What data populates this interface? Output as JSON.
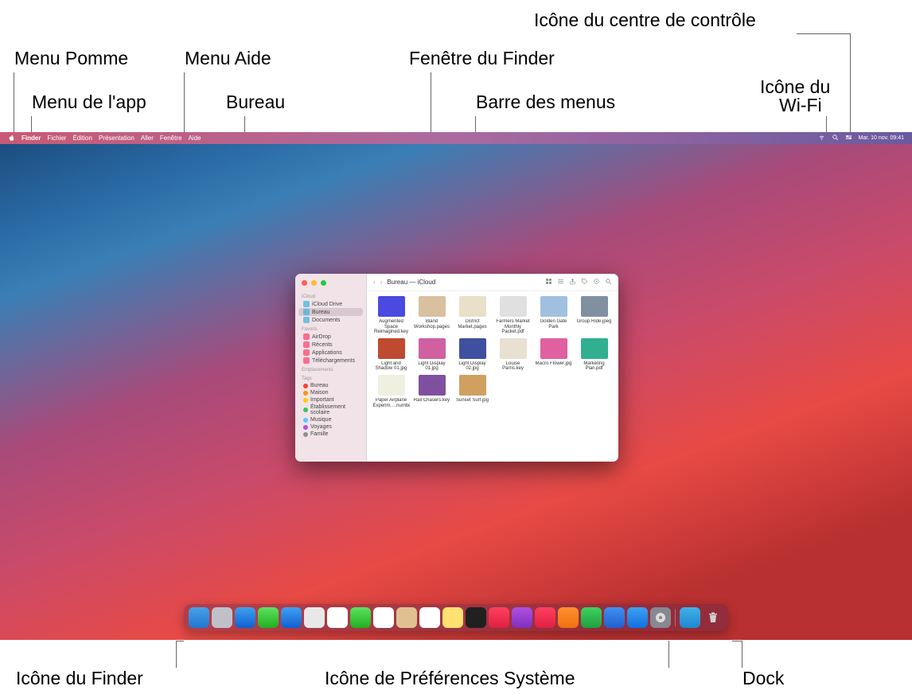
{
  "annotations": {
    "menuPomme": "Menu Pomme",
    "menuApp": "Menu de l'app",
    "menuAide": "Menu Aide",
    "bureau": "Bureau",
    "fenetreFinder": "Fenêtre du Finder",
    "barreMenus": "Barre des menus",
    "wifi1": "Icône du",
    "wifi2": "Wi-Fi",
    "controlCenter": "Icône du centre de contrôle",
    "finderIcon": "Icône du Finder",
    "sysPrefIcon": "Icône de Préférences Système",
    "dock": "Dock"
  },
  "menubar": {
    "items": [
      "Finder",
      "Fichier",
      "Édition",
      "Présentation",
      "Aller",
      "Fenêtre",
      "Aide"
    ],
    "datetime": "Mar. 10 nov.  09:41"
  },
  "finder": {
    "title": "Bureau — iCloud",
    "sidebar": {
      "sections": [
        {
          "header": "iCloud",
          "items": [
            {
              "label": "iCloud Drive",
              "icon": "cloud",
              "color": "#38b0de"
            },
            {
              "label": "Bureau",
              "icon": "folder",
              "color": "#38b0de",
              "selected": true
            },
            {
              "label": "Documents",
              "icon": "folder",
              "color": "#38b0de"
            }
          ]
        },
        {
          "header": "Favoris",
          "items": [
            {
              "label": "AirDrop",
              "icon": "airdrop",
              "color": "#ff3b6b"
            },
            {
              "label": "Récents",
              "icon": "clock",
              "color": "#ff3b6b"
            },
            {
              "label": "Applications",
              "icon": "app",
              "color": "#ff3b6b"
            },
            {
              "label": "Téléchargements",
              "icon": "download",
              "color": "#ff3b6b"
            }
          ]
        },
        {
          "header": "Emplacements",
          "items": []
        },
        {
          "header": "Tags",
          "items": [
            {
              "label": "Bureau",
              "dot": "#ff3b30"
            },
            {
              "label": "Maison",
              "dot": "#ff9500"
            },
            {
              "label": "Important",
              "dot": "#ffcc00"
            },
            {
              "label": "Établissement scolaire",
              "dot": "#34c759"
            },
            {
              "label": "Musique",
              "dot": "#5ac8fa"
            },
            {
              "label": "Voyages",
              "dot": "#af52de"
            },
            {
              "label": "Famille",
              "dot": "#8e8e93"
            }
          ]
        }
      ]
    },
    "files": [
      {
        "name": "Augmented Space Reimagined.key",
        "c": "#4a4ae0"
      },
      {
        "name": "Bland Workshop.pages",
        "c": "#d8c0a0"
      },
      {
        "name": "District Market.pages",
        "c": "#e8e0c8"
      },
      {
        "name": "Farmers Market Monthly Packet.pdf",
        "c": "#e0e0e0"
      },
      {
        "name": "Golden Gate Park",
        "c": "#a0c0e0"
      },
      {
        "name": "Group Ride.jpeg",
        "c": "#8090a0"
      },
      {
        "name": "Light and Shadow 01.jpg",
        "c": "#c04a30"
      },
      {
        "name": "Light Display 01.jpg",
        "c": "#d060a0"
      },
      {
        "name": "Light Display 02.jpg",
        "c": "#4050a0"
      },
      {
        "name": "Louise Parris.key",
        "c": "#e8e0d0"
      },
      {
        "name": "Macro Flower.jpg",
        "c": "#e060a0"
      },
      {
        "name": "Marketing Plan.pdf",
        "c": "#30b090"
      },
      {
        "name": "Paper Airplane Experim….numbers",
        "c": "#f0f0e0"
      },
      {
        "name": "Rail Chasers.key",
        "c": "#8050a0"
      },
      {
        "name": "Sunset Surf.jpg",
        "c": "#d0a060"
      }
    ]
  },
  "dock": [
    {
      "name": "finder",
      "bg": "linear-gradient(#4aa0e8,#2078d0)"
    },
    {
      "name": "launchpad",
      "bg": "#c0c0c8"
    },
    {
      "name": "safari",
      "bg": "linear-gradient(#40a0f0,#1060d0)"
    },
    {
      "name": "messages",
      "bg": "linear-gradient(#60e060,#20b020)"
    },
    {
      "name": "mail",
      "bg": "linear-gradient(#40a0f0,#1060d0)"
    },
    {
      "name": "maps",
      "bg": "#e8e8e8"
    },
    {
      "name": "photos",
      "bg": "#ffffff"
    },
    {
      "name": "facetime",
      "bg": "linear-gradient(#60e060,#20b020)"
    },
    {
      "name": "calendar",
      "bg": "#ffffff"
    },
    {
      "name": "contacts",
      "bg": "#e0c090"
    },
    {
      "name": "reminders",
      "bg": "#ffffff"
    },
    {
      "name": "notes",
      "bg": "#ffe070"
    },
    {
      "name": "tv",
      "bg": "#202020"
    },
    {
      "name": "music",
      "bg": "linear-gradient(#ff4060,#e02040)"
    },
    {
      "name": "podcasts",
      "bg": "linear-gradient(#b050e0,#8030c0)"
    },
    {
      "name": "news",
      "bg": "linear-gradient(#ff4060,#e02040)"
    },
    {
      "name": "pages",
      "bg": "linear-gradient(#ff9030,#f07010)"
    },
    {
      "name": "numbers",
      "bg": "linear-gradient(#40d060,#20a040)"
    },
    {
      "name": "keynote",
      "bg": "linear-gradient(#4090f0,#2060d0)"
    },
    {
      "name": "appstore",
      "bg": "linear-gradient(#40a0f0,#1070e0)"
    },
    {
      "name": "system-preferences",
      "bg": "#888890"
    },
    {
      "sep": true
    },
    {
      "name": "downloads",
      "bg": "linear-gradient(#40b0e8,#2088d0)"
    },
    {
      "name": "trash",
      "bg": "transparent"
    }
  ]
}
